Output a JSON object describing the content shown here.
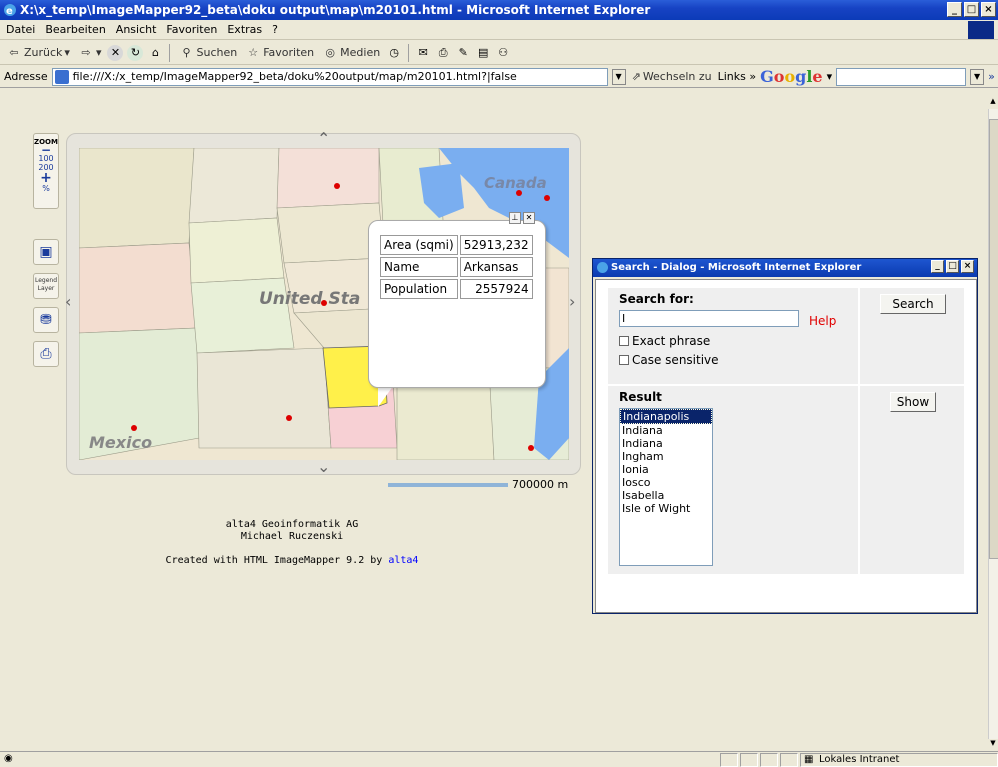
{
  "browser": {
    "title": "X:\\x_temp\\ImageMapper92_beta\\doku output\\map\\m20101.html - Microsoft Internet Explorer",
    "menu": [
      "Datei",
      "Bearbeiten",
      "Ansicht",
      "Favoriten",
      "Extras",
      "?"
    ],
    "toolbar": {
      "back": "Zurück",
      "search": "Suchen",
      "favorites": "Favoriten",
      "media": "Medien"
    },
    "address_label": "Adresse",
    "address_value": "file:///X:/x_temp/ImageMapper92_beta/doku%20output/map/m20101.html?|false",
    "go_label": "Wechseln zu",
    "links_label": "Links",
    "google_label": "Google",
    "status_zone": "Lokales Intranet"
  },
  "map_tools": {
    "zoom_label": "ZOOM",
    "zoom_levels": [
      "100",
      "200"
    ],
    "zoom_percent": "%",
    "legend_label": "Legend",
    "legend_sub": "Layer"
  },
  "map": {
    "labels": {
      "country": "United Sta",
      "canada": "Canada",
      "mexico": "Mexico"
    },
    "scale_label": "700000 m"
  },
  "popup": {
    "rows": [
      {
        "key": "Area (sqmi)",
        "value": "52913,232"
      },
      {
        "key": "Name",
        "value": "Arkansas"
      },
      {
        "key": "Population",
        "value": "2557924"
      }
    ]
  },
  "credits": {
    "line1": "alta4 Geoinformatik AG",
    "line2": "Michael Ruczenski",
    "line3": "Created with HTML ImageMapper 9.2 by",
    "link": "alta4"
  },
  "dialog": {
    "title": "Search - Dialog - Microsoft Internet Explorer",
    "search_for": "Search for:",
    "search_value": "I",
    "help": "Help",
    "exact_phrase": "Exact phrase",
    "case_sensitive": "Case sensitive",
    "search_button": "Search",
    "result_label": "Result",
    "show_button": "Show",
    "results": [
      "Indianapolis",
      "Indiana",
      "Indiana",
      "Ingham",
      "Ionia",
      "Iosco",
      "Isabella",
      "Isle of Wight"
    ],
    "selected_index": 0
  }
}
